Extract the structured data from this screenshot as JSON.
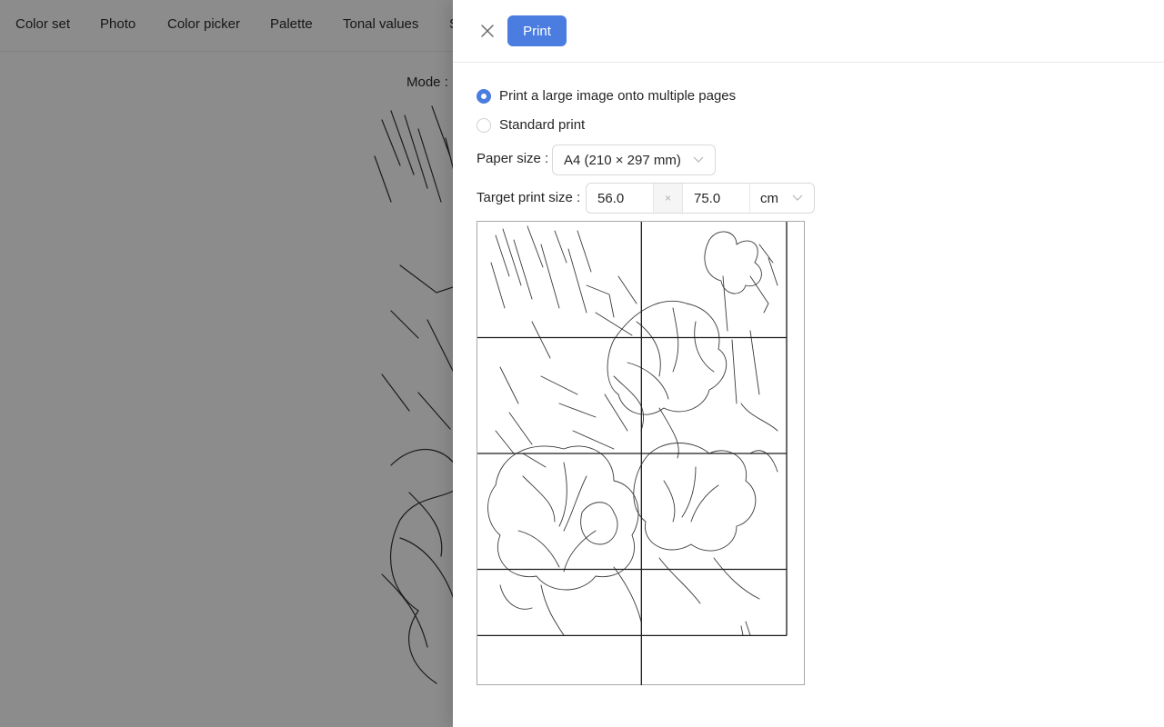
{
  "background": {
    "nav_tabs": [
      "Color set",
      "Photo",
      "Color picker",
      "Palette",
      "Tonal values",
      "S"
    ],
    "mode_label": "Mode :"
  },
  "drawer": {
    "print_button": "Print",
    "print_mode": {
      "options": [
        {
          "label": "Print a large image onto multiple pages",
          "checked": true
        },
        {
          "label": "Standard print",
          "checked": false
        }
      ]
    },
    "paper_size": {
      "label": "Paper size :",
      "value": "A4 (210 × 297 mm)"
    },
    "target_print_size": {
      "label": "Target print size :",
      "width": "56.0",
      "separator": "×",
      "height": "75.0",
      "unit": "cm"
    },
    "preview": {
      "page_columns": 2,
      "page_rows": 4,
      "page_orientation": "landscape",
      "image_width_cm": 56.0,
      "image_height_cm": 75.0,
      "page_width_cm": 29.7,
      "page_height_cm": 21.0
    }
  },
  "colors": {
    "accent": "#4a7ddf",
    "overlay": "rgba(0,0,0,0.45)"
  }
}
